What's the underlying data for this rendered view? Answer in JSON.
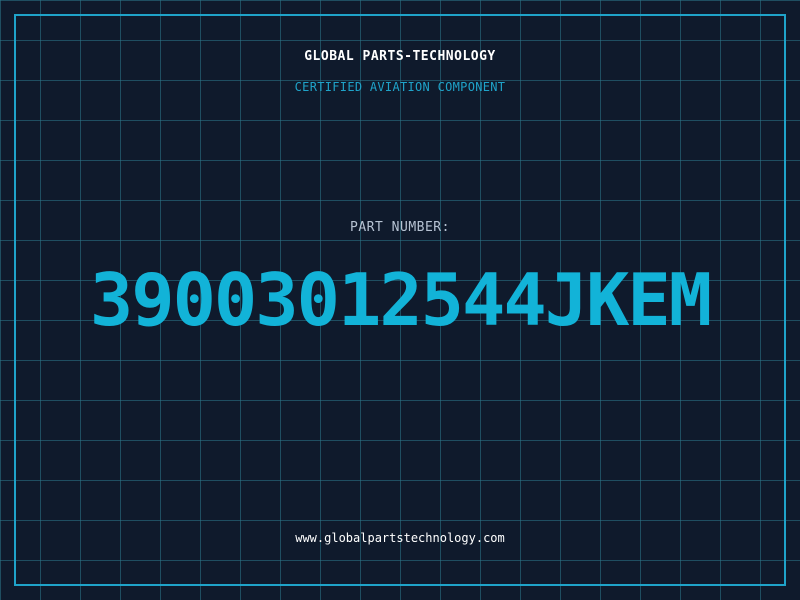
{
  "header": {
    "company": "GLOBAL PARTS-TECHNOLOGY",
    "subtitle": "CERTIFIED AVIATION COMPONENT"
  },
  "part": {
    "label": "PART NUMBER:",
    "number": "39003012544JKEM"
  },
  "footer": {
    "website": "www.globalpartstechnology.com"
  },
  "colors": {
    "background": "#0f1a2c",
    "accent": "#1fa3c9",
    "part_number": "#12b3d8",
    "label": "#b7c3d3",
    "text": "#ffffff"
  }
}
